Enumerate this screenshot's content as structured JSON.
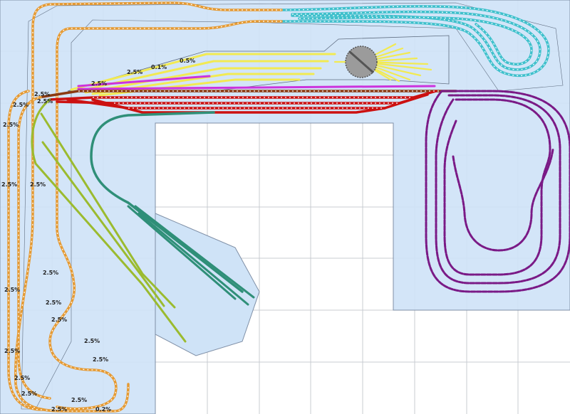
{
  "grade_labels": [
    "2.5%",
    "2.5%",
    "2.5%",
    "2.5%",
    "2.5%",
    "2.5%",
    "2.5%",
    "2.5%",
    "2.5%",
    "2.5%",
    "2.5%",
    "2.5%",
    "2.5%",
    "2.5%",
    "2.5%",
    "2.5%",
    "2.5%",
    "0.1%",
    "0.5%",
    "0.2%",
    "2.5%",
    "2.5%"
  ],
  "colors": {
    "board": "#cfe3f7",
    "grid": "#c8ccd2",
    "cyan": "#3fc0cc",
    "orange": "#e59a33",
    "yellow": "#f2ea52",
    "magenta": "#cc33dd",
    "red": "#cc1111",
    "brown": "#8b3a12",
    "teal": "#2f8f78",
    "olive": "#9bbb2f",
    "purple": "#7a1a86",
    "turntable": "#9b9b9b"
  },
  "icons": [
    "turntable-icon"
  ]
}
